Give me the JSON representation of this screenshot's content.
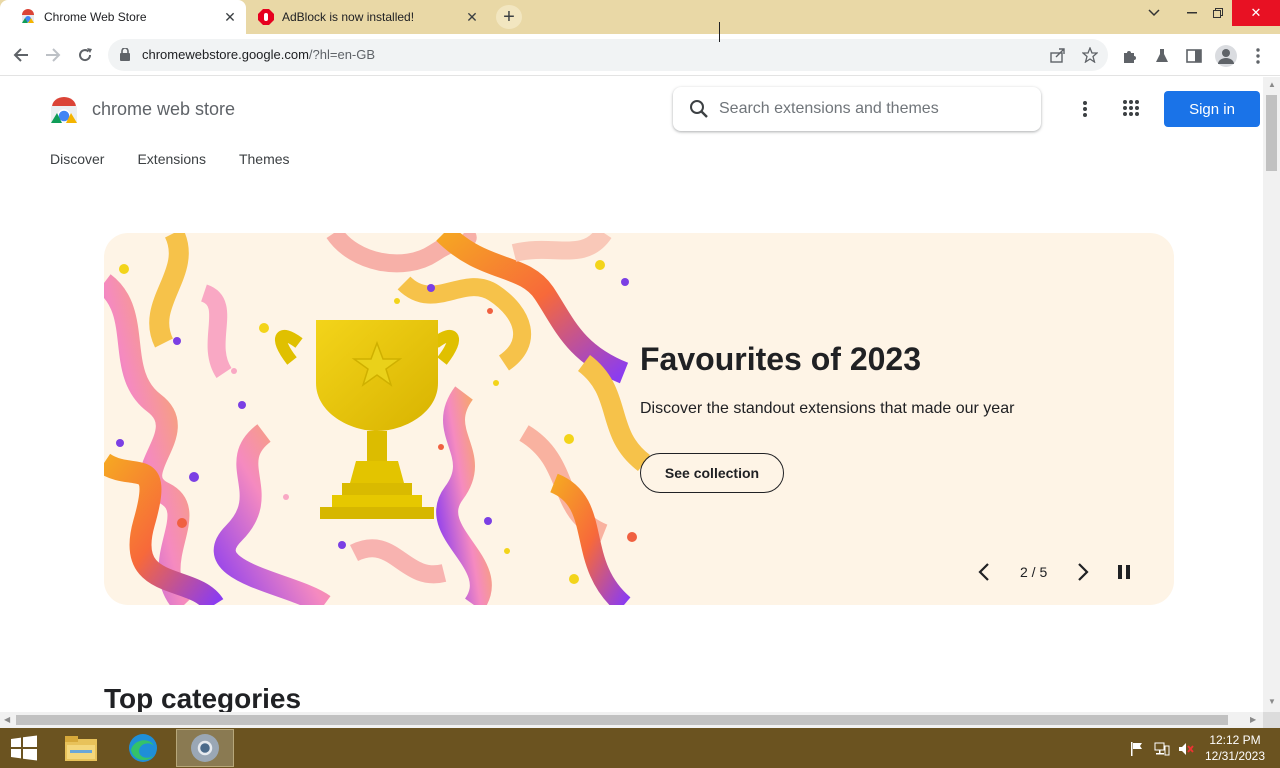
{
  "browser": {
    "tabs": [
      {
        "title": "Chrome Web Store",
        "active": true
      },
      {
        "title": "AdBlock is now installed!",
        "active": false
      }
    ],
    "new_tab_label": "+",
    "url_host": "chromewebstore.google.com",
    "url_rest": "/?hl=en-GB"
  },
  "header": {
    "brand": "chrome web store",
    "search_placeholder": "Search extensions and themes",
    "sign_in": "Sign in"
  },
  "nav": {
    "items": [
      "Discover",
      "Extensions",
      "Themes"
    ]
  },
  "hero": {
    "title": "Favourites of 2023",
    "subtitle": "Discover the standout extensions that made our year",
    "button": "See collection",
    "counter": "2 / 5"
  },
  "sections": {
    "top_categories": "Top categories"
  },
  "taskbar": {
    "time": "12:12 PM",
    "date": "12/31/2023"
  },
  "colors": {
    "accent": "#1a73e8",
    "hero_bg": "#fef4e6",
    "titlebar": "#e9d8a6",
    "taskbar": "#6b5320"
  }
}
